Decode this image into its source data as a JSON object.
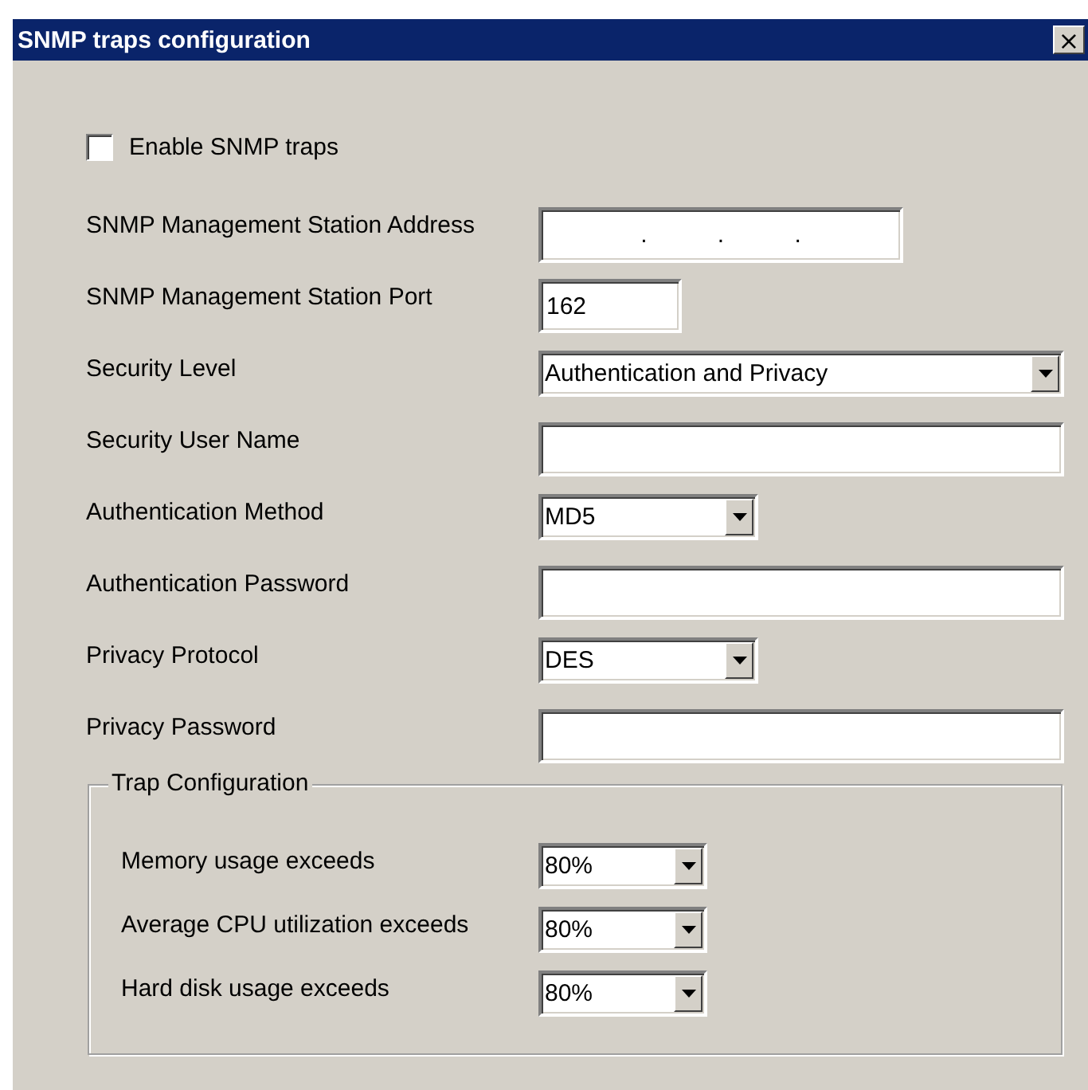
{
  "window": {
    "title": "SNMP traps configuration",
    "close": "×"
  },
  "enable": {
    "label": "Enable SNMP traps",
    "checked": false
  },
  "fields": [
    {
      "kind": "ip",
      "label": "SNMP Management Station Address",
      "separators": [
        ".",
        ".",
        "."
      ]
    },
    {
      "kind": "text",
      "label": "SNMP Management Station Port",
      "value": "162"
    },
    {
      "kind": "combo",
      "label": "Security Level",
      "value": "Authentication and Privacy"
    },
    {
      "kind": "text",
      "label": "Security User Name"
    },
    {
      "kind": "combo",
      "label": "Authentication Method",
      "value": "MD5"
    },
    {
      "kind": "text",
      "label": "Authentication Password"
    },
    {
      "kind": "combo",
      "label": "Privacy Protocol",
      "value": "DES"
    },
    {
      "kind": "text",
      "label": "Privacy Password"
    }
  ],
  "trap_configuration": {
    "title": "Trap Configuration",
    "rows": [
      {
        "label": "Memory usage exceeds",
        "value": "80%"
      },
      {
        "label": "Average CPU utilization exceeds",
        "value": "80%"
      },
      {
        "label": "Hard disk usage exceeds",
        "value": "80%"
      }
    ]
  }
}
